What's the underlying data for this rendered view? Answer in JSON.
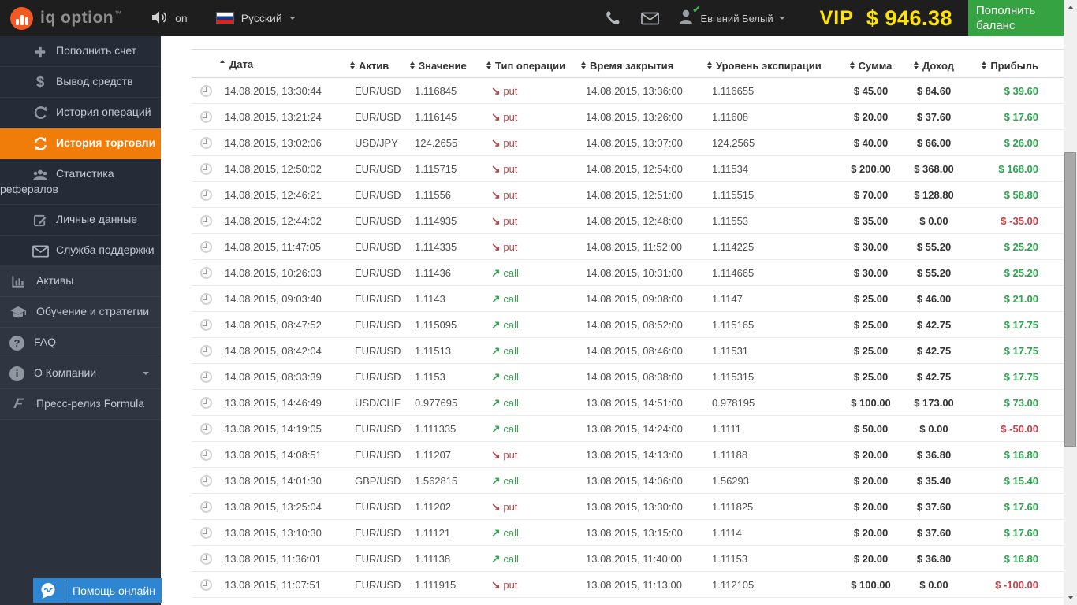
{
  "topbar": {
    "brand": "iq option",
    "brand_tm": "™",
    "sound_on_label": "on",
    "language": "Русский",
    "username": "Евгений Белый",
    "vip_label": "VIP",
    "balance": "$ 946.38",
    "deposit_button": "Пополнить баланс"
  },
  "sidebar": {
    "items": [
      {
        "label": "Пополнить счет"
      },
      {
        "label": "Вывод средств"
      },
      {
        "label": "История операций"
      },
      {
        "label": "История торговли",
        "active": true
      },
      {
        "label": "Статистика рефералов"
      },
      {
        "label": "Личные данные"
      },
      {
        "label": "Служба поддержки"
      },
      {
        "label": "Активы"
      },
      {
        "label": "Обучение и стратегии"
      },
      {
        "label": "FAQ"
      },
      {
        "label": "О Компании"
      },
      {
        "label": "Пресс-релиз Formula"
      }
    ]
  },
  "help_button": {
    "label": "Помощь онлайн"
  },
  "table": {
    "columns": [
      {
        "key": "",
        "label": "",
        "sort": "",
        "align": "left"
      },
      {
        "key": "date",
        "label": "Дата",
        "sort": "asc",
        "align": "left"
      },
      {
        "key": "asset",
        "label": "Актив",
        "sort": "both",
        "align": "left"
      },
      {
        "key": "value",
        "label": "Значение",
        "sort": "both",
        "align": "left"
      },
      {
        "key": "type",
        "label": "Тип операции",
        "sort": "both",
        "align": "left"
      },
      {
        "key": "close_time",
        "label": "Время закрытия",
        "sort": "both",
        "align": "left"
      },
      {
        "key": "expiry_level",
        "label": "Уровень экспирации",
        "sort": "both",
        "align": "left"
      },
      {
        "key": "amount",
        "label": "Сумма",
        "sort": "both",
        "align": "center"
      },
      {
        "key": "income",
        "label": "Доход",
        "sort": "both",
        "align": "center"
      },
      {
        "key": "profit",
        "label": "Прибыль",
        "sort": "both",
        "align": "right"
      }
    ],
    "rows": [
      {
        "date": "14.08.2015, 13:30:44",
        "asset": "EUR/USD",
        "value": "1.116845",
        "type": "put",
        "close_time": "14.08.2015, 13:36:00",
        "expiry_level": "1.116655",
        "amount": "$ 45.00",
        "income": "$ 84.60",
        "profit": "$ 39.60"
      },
      {
        "date": "14.08.2015, 13:21:24",
        "asset": "EUR/USD",
        "value": "1.116145",
        "type": "put",
        "close_time": "14.08.2015, 13:26:00",
        "expiry_level": "1.11608",
        "amount": "$ 20.00",
        "income": "$ 37.60",
        "profit": "$ 17.60"
      },
      {
        "date": "14.08.2015, 13:02:06",
        "asset": "USD/JPY",
        "value": "124.2655",
        "type": "put",
        "close_time": "14.08.2015, 13:07:00",
        "expiry_level": "124.2565",
        "amount": "$ 40.00",
        "income": "$ 66.00",
        "profit": "$ 26.00"
      },
      {
        "date": "14.08.2015, 12:50:02",
        "asset": "EUR/USD",
        "value": "1.115715",
        "type": "put",
        "close_time": "14.08.2015, 12:54:00",
        "expiry_level": "1.11534",
        "amount": "$ 200.00",
        "income": "$ 368.00",
        "profit": "$ 168.00"
      },
      {
        "date": "14.08.2015, 12:46:21",
        "asset": "EUR/USD",
        "value": "1.11556",
        "type": "put",
        "close_time": "14.08.2015, 12:51:00",
        "expiry_level": "1.115515",
        "amount": "$ 70.00",
        "income": "$ 128.80",
        "profit": "$ 58.80"
      },
      {
        "date": "14.08.2015, 12:44:02",
        "asset": "EUR/USD",
        "value": "1.114935",
        "type": "put",
        "close_time": "14.08.2015, 12:48:00",
        "expiry_level": "1.11553",
        "amount": "$ 35.00",
        "income": "$ 0.00",
        "profit": "$ -35.00"
      },
      {
        "date": "14.08.2015, 11:47:05",
        "asset": "EUR/USD",
        "value": "1.114335",
        "type": "put",
        "close_time": "14.08.2015, 11:52:00",
        "expiry_level": "1.114225",
        "amount": "$ 30.00",
        "income": "$ 55.20",
        "profit": "$ 25.20"
      },
      {
        "date": "14.08.2015, 10:26:03",
        "asset": "EUR/USD",
        "value": "1.11436",
        "type": "call",
        "close_time": "14.08.2015, 10:31:00",
        "expiry_level": "1.114665",
        "amount": "$ 30.00",
        "income": "$ 55.20",
        "profit": "$ 25.20"
      },
      {
        "date": "14.08.2015, 09:03:40",
        "asset": "EUR/USD",
        "value": "1.1143",
        "type": "call",
        "close_time": "14.08.2015, 09:08:00",
        "expiry_level": "1.1147",
        "amount": "$ 25.00",
        "income": "$ 46.00",
        "profit": "$ 21.00"
      },
      {
        "date": "14.08.2015, 08:47:52",
        "asset": "EUR/USD",
        "value": "1.115095",
        "type": "call",
        "close_time": "14.08.2015, 08:52:00",
        "expiry_level": "1.115165",
        "amount": "$ 25.00",
        "income": "$ 42.75",
        "profit": "$ 17.75"
      },
      {
        "date": "14.08.2015, 08:42:04",
        "asset": "EUR/USD",
        "value": "1.11513",
        "type": "call",
        "close_time": "14.08.2015, 08:46:00",
        "expiry_level": "1.11531",
        "amount": "$ 25.00",
        "income": "$ 42.75",
        "profit": "$ 17.75"
      },
      {
        "date": "14.08.2015, 08:33:39",
        "asset": "EUR/USD",
        "value": "1.1153",
        "type": "call",
        "close_time": "14.08.2015, 08:38:00",
        "expiry_level": "1.115315",
        "amount": "$ 25.00",
        "income": "$ 42.75",
        "profit": "$ 17.75"
      },
      {
        "date": "13.08.2015, 14:46:49",
        "asset": "USD/CHF",
        "value": "0.977695",
        "type": "call",
        "close_time": "13.08.2015, 14:51:00",
        "expiry_level": "0.978195",
        "amount": "$ 100.00",
        "income": "$ 173.00",
        "profit": "$ 73.00"
      },
      {
        "date": "13.08.2015, 14:19:05",
        "asset": "EUR/USD",
        "value": "1.111335",
        "type": "call",
        "close_time": "13.08.2015, 14:24:00",
        "expiry_level": "1.1111",
        "amount": "$ 50.00",
        "income": "$ 0.00",
        "profit": "$ -50.00"
      },
      {
        "date": "13.08.2015, 14:08:51",
        "asset": "EUR/USD",
        "value": "1.11207",
        "type": "put",
        "close_time": "13.08.2015, 14:13:00",
        "expiry_level": "1.11188",
        "amount": "$ 20.00",
        "income": "$ 36.80",
        "profit": "$ 16.80"
      },
      {
        "date": "13.08.2015, 14:01:30",
        "asset": "GBP/USD",
        "value": "1.562815",
        "type": "call",
        "close_time": "13.08.2015, 14:06:00",
        "expiry_level": "1.56293",
        "amount": "$ 20.00",
        "income": "$ 35.40",
        "profit": "$ 15.40"
      },
      {
        "date": "13.08.2015, 13:25:04",
        "asset": "EUR/USD",
        "value": "1.11202",
        "type": "put",
        "close_time": "13.08.2015, 13:30:00",
        "expiry_level": "1.111825",
        "amount": "$ 20.00",
        "income": "$ 37.60",
        "profit": "$ 17.60"
      },
      {
        "date": "13.08.2015, 13:10:30",
        "asset": "EUR/USD",
        "value": "1.11121",
        "type": "call",
        "close_time": "13.08.2015, 13:15:00",
        "expiry_level": "1.1114",
        "amount": "$ 20.00",
        "income": "$ 37.60",
        "profit": "$ 17.60"
      },
      {
        "date": "13.08.2015, 11:36:01",
        "asset": "EUR/USD",
        "value": "1.11138",
        "type": "call",
        "close_time": "13.08.2015, 11:40:00",
        "expiry_level": "1.11153",
        "amount": "$ 20.00",
        "income": "$ 36.80",
        "profit": "$ 16.80"
      },
      {
        "date": "13.08.2015, 11:07:51",
        "asset": "EUR/USD",
        "value": "1.111915",
        "type": "put",
        "close_time": "13.08.2015, 11:13:00",
        "expiry_level": "1.112105",
        "amount": "$ 100.00",
        "income": "$ 0.00",
        "profit": "$ -100.00"
      }
    ]
  },
  "colors": {
    "accent_orange": "#f07d0a",
    "topbar_bg": "#1e1e1e",
    "sidebar_bg": "#2b323d",
    "profit_green": "#2fa44e",
    "loss_red": "#c2434b",
    "put_red": "#b0494e",
    "call_green": "#3aa356",
    "vip_yellow": "#ffe400",
    "deposit_green": "#35a342",
    "help_blue": "#2e86d2"
  }
}
